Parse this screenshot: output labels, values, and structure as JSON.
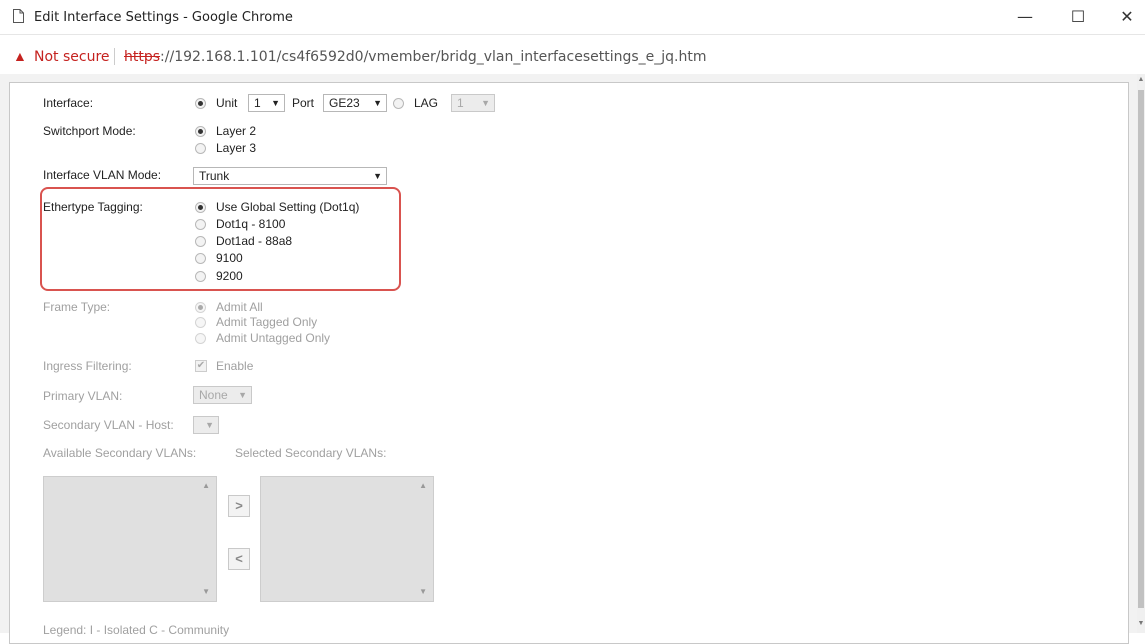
{
  "window": {
    "title": "Edit Interface Settings - Google Chrome",
    "minimize": "—",
    "maximize": "☐",
    "close": "✕"
  },
  "address": {
    "security": "Not secure",
    "protocol": "https",
    "url_rest": "://192.168.1.101/cs4f6592d0/vmember/bridg_vlan_interfacesettings_e_jq.htm"
  },
  "form": {
    "interface": {
      "label": "Interface:",
      "unit_label": "Unit",
      "unit_value": "1",
      "port_label": "Port",
      "port_value": "GE23",
      "lag_label": "LAG",
      "lag_value": "1"
    },
    "switchport": {
      "label": "Switchport Mode:",
      "options": [
        "Layer 2",
        "Layer 3"
      ]
    },
    "vlan_mode": {
      "label": "Interface VLAN Mode:",
      "value": "Trunk"
    },
    "ethertype": {
      "label": "Ethertype Tagging:",
      "options": [
        "Use Global Setting (Dot1q)",
        "Dot1q - 8100",
        "Dot1ad - 88a8",
        "9100",
        "9200"
      ]
    },
    "frame_type": {
      "label": "Frame Type:",
      "options": [
        "Admit All",
        "Admit Tagged Only",
        "Admit Untagged Only"
      ]
    },
    "ingress": {
      "label": "Ingress Filtering:",
      "checkbox_label": "Enable"
    },
    "primary_vlan": {
      "label": "Primary VLAN:",
      "value": "None"
    },
    "secondary_host": {
      "label": "Secondary VLAN - Host:"
    },
    "available_label": "Available Secondary VLANs:",
    "selected_label": "Selected Secondary VLANs:",
    "legend": "Legend: I - Isolated C - Community"
  },
  "icons": {
    "move_right": ">",
    "move_left": "<"
  }
}
